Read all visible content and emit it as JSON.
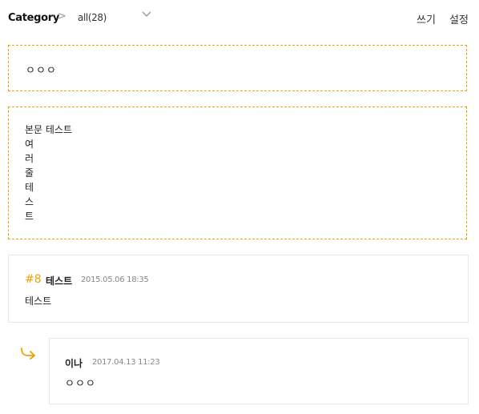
{
  "header": {
    "category_label": "Category",
    "separator_icon": "chevron-right-icon",
    "category_select": "all(28)",
    "dropdown_icon": "chevron-down-icon",
    "write_label": "쓰기",
    "settings_label": "설정"
  },
  "post": {
    "title": "ㅇㅇㅇ",
    "body_lines": [
      "본문 테스트",
      "여",
      "러",
      "줄",
      "테",
      "스",
      "트"
    ]
  },
  "comments": [
    {
      "number": "#8",
      "author": "테스트",
      "date": "2015.05.06 18:35",
      "body": "테스트"
    }
  ],
  "replies": [
    {
      "icon": "reply-arrow-icon",
      "author": "이나",
      "date": "2017.04.13 11:23",
      "body": "ㅇㅇㅇ"
    }
  ],
  "colors": {
    "accent": "#f0a200",
    "border": "#e6e6e6",
    "muted_text": "#888888"
  }
}
